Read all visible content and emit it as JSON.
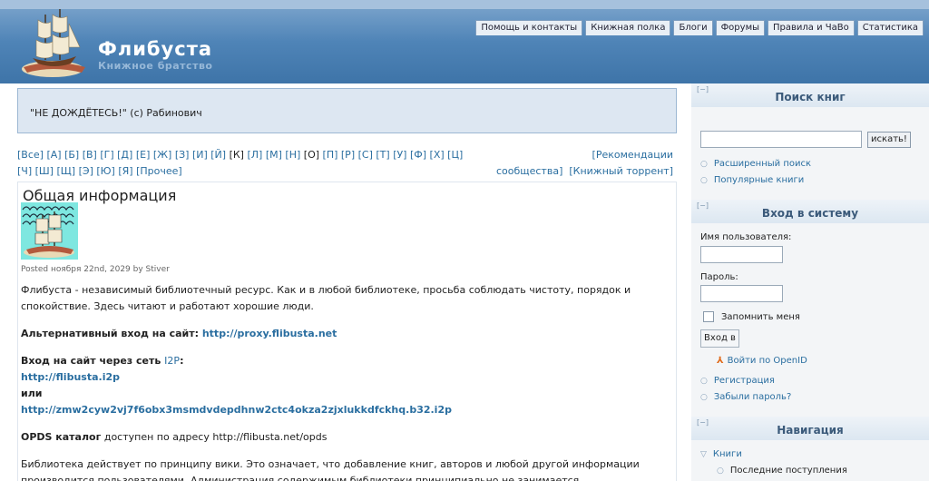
{
  "header": {
    "site_name": "Флибуста",
    "slogan": "Книжное братство",
    "tabs": [
      {
        "label": "Помощь и контакты"
      },
      {
        "label": "Книжная полка"
      },
      {
        "label": "Блоги"
      },
      {
        "label": "Форумы"
      },
      {
        "label": "Правила и ЧаВо"
      },
      {
        "label": "Статистика"
      }
    ]
  },
  "quote": "\"НЕ ДОЖДЁТЕСЬ!\" (c) Рабинович",
  "alphabet": {
    "row1": [
      "[Все]",
      "[А]",
      "[Б]",
      "[В]",
      "[Г]",
      "[Д]",
      "[Е]",
      "[Ж]",
      "[З]",
      "[И]",
      "[Й]",
      "[К]",
      "[Л]",
      "[М]",
      "[Н]",
      "[О]",
      "[П]",
      "[Р]",
      "[С]",
      "[Т]",
      "[У]",
      "[Ф]",
      "[Х]",
      "[Ц]"
    ],
    "row2": [
      "[Ч]",
      "[Ш]",
      "[Щ]",
      "[Э]",
      "[Ю]",
      "[Я]",
      "[Прочее]"
    ],
    "current": [
      "[К]",
      "[О]"
    ]
  },
  "community": {
    "recommend_line1": "[Рекомендации",
    "recommend_line2": "сообщества]",
    "torrent": "[Книжный торрент]"
  },
  "node": {
    "title": "Общая информация",
    "submitted": "Posted ноября 22nd, 2029 by Stiver",
    "intro": "Флибуста - независимый библиотечный ресурс. Как и в любой библиотеке, просьба соблюдать чистоту, порядок и спокойствие. Здесь читают и работают хорошие люди.",
    "alt_label": "Альтернативный вход на сайт:",
    "alt_link": "http://proxy.flibusta.net",
    "i2p_label_start": "Вход на сайт через сеть ",
    "i2p_word": "I2P",
    "i2p_label_end": ":",
    "i2p_link1": "http://flibusta.i2p",
    "or": "или",
    "i2p_link2": "http://zmw2cyw2vj7f6obx3msmdvdepdhnw2ctc4okza2zjxlukkdfckhq.b32.i2p",
    "opds_label": "OPDS каталог",
    "opds_text": " доступен по адресу http://flibusta.net/opds",
    "wiki": "Библиотека действует по принципу вики. Это означает, что добавление книг, авторов и любой другой информации производится пользователями. Администрация содержимым библиотеки принципиально не занимается."
  },
  "sidebar": {
    "collapse": "[−]",
    "search": {
      "title": "Поиск книг",
      "button": "искать!",
      "advanced": "Расширенный поиск",
      "popular": "Популярные книги"
    },
    "login": {
      "title": "Вход в систему",
      "username_label": "Имя пользователя:",
      "password_label": "Пароль:",
      "remember": "Запомнить меня",
      "button": "Вход в",
      "openid": "Войти по OpenID",
      "register": "Регистрация",
      "forgot": "Забыли пароль?"
    },
    "nav": {
      "title": "Навигация",
      "books": "Книги",
      "latest": "Последние поступления"
    }
  }
}
